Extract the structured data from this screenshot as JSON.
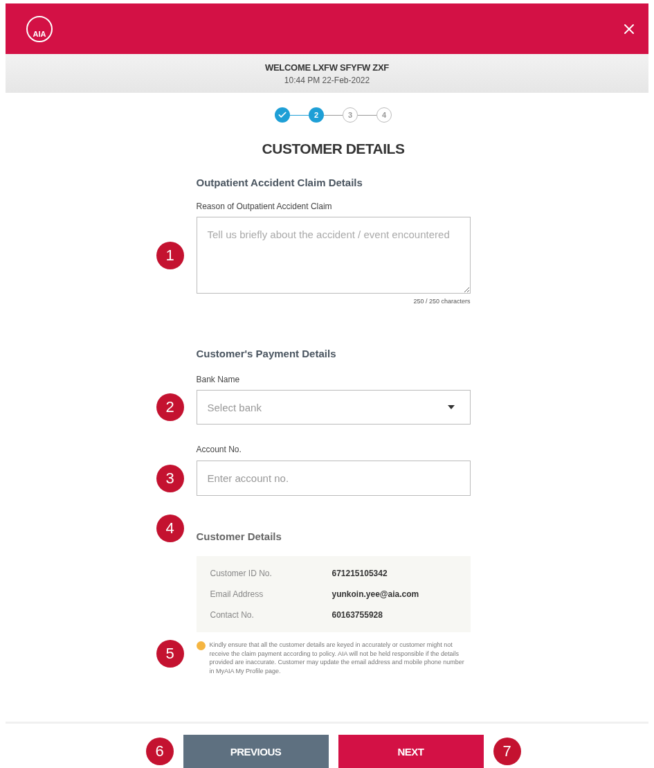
{
  "header": {
    "logo_text": "AIA"
  },
  "welcome": {
    "greeting": "WELCOME LXFW SFYFW ZXF",
    "datetime": "10:44 PM 22-Feb-2022"
  },
  "steps": [
    {
      "kind": "done"
    },
    {
      "kind": "current",
      "label": "2"
    },
    {
      "kind": "upcoming",
      "label": "3"
    },
    {
      "kind": "upcoming",
      "label": "4"
    }
  ],
  "title": "CUSTOMER DETAILS",
  "claim": {
    "heading": "Outpatient Accident Claim Details",
    "label": "Reason of Outpatient Accident Claim",
    "placeholder": "Tell us briefly about the accident / event encountered",
    "counter": "250 / 250 characters",
    "callout": "1"
  },
  "payment": {
    "heading": "Customer's Payment Details",
    "bank": {
      "label": "Bank Name",
      "placeholder": "Select bank",
      "callout": "2"
    },
    "account": {
      "label": "Account No.",
      "placeholder": "Enter account no.",
      "callout": "3"
    }
  },
  "customer": {
    "heading": "Customer Details",
    "callout": "4",
    "rows": [
      {
        "label": "Customer ID No.",
        "value": "671215105342"
      },
      {
        "label": "Email Address",
        "value": "yunkoin.yee@aia.com"
      },
      {
        "label": "Contact No.",
        "value": "60163755928"
      }
    ],
    "note": "Kindly ensure that all the customer details are keyed in accurately or customer might not receive the claim payment according to policy. AIA will not be held responsible if the details provided are inaccurate. Customer may update the email address and mobile phone number in MyAIA My Profile page.",
    "note_callout": "5"
  },
  "footer": {
    "previous": "PREVIOUS",
    "next": "NEXT",
    "previous_callout": "6",
    "next_callout": "7"
  }
}
